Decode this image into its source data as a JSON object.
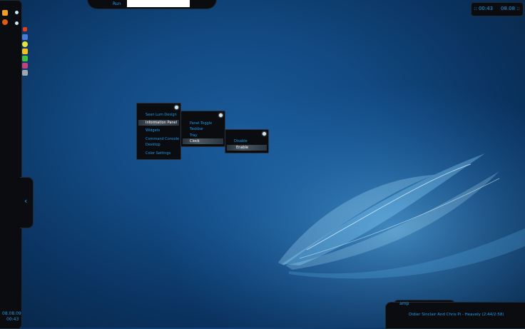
{
  "run": {
    "label": "Run",
    "input_value": ""
  },
  "clock": {
    "time": ":: 00:43",
    "date": "08.08 ::"
  },
  "sidebar": {
    "date": "08.08.09",
    "time": "00:43",
    "expand_glyph": "‹",
    "icons": [
      "orange-star-icon",
      "firefox-icon",
      "monitor-icon",
      "speaker-icon",
      "monitor-icon",
      "sun-icon",
      "runner-icon",
      "green-figure-icon",
      "chip-icon",
      "drive-icon"
    ]
  },
  "menus": {
    "main": {
      "items": [
        "Sean Lum Design",
        "Information Panel",
        "Widgets",
        "Command Console",
        "Desktop",
        "Color Settings"
      ]
    },
    "info": {
      "items": [
        "Panel Toggle",
        "Taskbar",
        "Tray",
        "Clock"
      ]
    },
    "clock": {
      "items": [
        "Disable",
        "Enable"
      ]
    }
  },
  "amp": {
    "label": "amp",
    "track": "Didier Sinclair And Chris Pi - Heavely  (2:44/2:58)"
  }
}
